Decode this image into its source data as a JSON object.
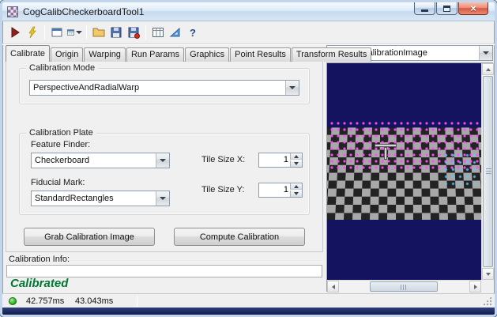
{
  "window": {
    "title": "CogCalibCheckerboardTool1"
  },
  "toolbar": {
    "buttons": [
      "run",
      "electric-run",
      "current-record",
      "record-display",
      "open",
      "save",
      "save-image",
      "results-grid",
      "units",
      "help"
    ]
  },
  "tabs": {
    "active": "Calibrate",
    "items": [
      "Calibrate",
      "Origin",
      "Warping",
      "Run Params",
      "Graphics",
      "Point Results",
      "Transform Results"
    ]
  },
  "calibration_mode": {
    "group_label": "Calibration Mode",
    "value": "PerspectiveAndRadialWarp"
  },
  "calibration_plate": {
    "group_label": "Calibration Plate",
    "feature_finder": {
      "label": "Feature Finder:",
      "value": "Checkerboard"
    },
    "fiducial_mark": {
      "label": "Fiducial Mark:",
      "value": "StandardRectangles"
    },
    "tile_size_x": {
      "label": "Tile Size X:",
      "value": "1"
    },
    "tile_size_y": {
      "label": "Tile Size Y:",
      "value": "1"
    }
  },
  "actions": {
    "grab": "Grab Calibration Image",
    "compute": "Compute Calibration"
  },
  "calibration_info": {
    "label": "Calibration Info:",
    "value": "",
    "status": "Calibrated"
  },
  "image_panel": {
    "selected_image": "Current.CalibrationImage"
  },
  "status_bar": {
    "time_1": "42.757ms",
    "time_2": "43.043ms"
  },
  "colors": {
    "calibrated_green": "#007a33",
    "image_background": "#131360",
    "mark_magenta": "#ff4cff",
    "status_led_green": "#2db82d"
  }
}
